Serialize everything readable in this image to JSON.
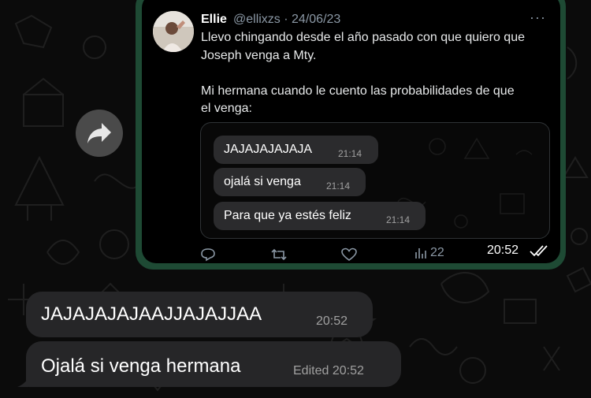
{
  "tweet": {
    "author_name": "Ellie",
    "handle": "@ellixzs",
    "date": "24/06/23",
    "more": "···",
    "text": "Llevo chingando desde el año pasado con que quiero que\nJoseph venga a Mty.\n\nMi hermana cuando le cuento las probabilidades de que\nel venga:",
    "embedded_messages": [
      {
        "text": "JAJAJAJAJAJA",
        "time": "21:14"
      },
      {
        "text": "ojalá si venga",
        "time": "21:14"
      },
      {
        "text": "Para que ya estés feliz",
        "time": "21:14"
      }
    ],
    "actions": {
      "views": "22"
    }
  },
  "outgoing": {
    "time": "20:52",
    "status": "read"
  },
  "incoming": [
    {
      "text": "JAJAJAJAJAAJJAJAJJAA",
      "time": "20:52"
    },
    {
      "text": "Ojalá si venga hermana",
      "edited": "Edited",
      "time": "20:52"
    }
  ],
  "icons": {
    "forward": "forward-arrow-icon",
    "reply": "reply-icon",
    "retweet": "retweet-icon",
    "like": "heart-icon",
    "views": "views-icon",
    "read": "double-check-icon"
  },
  "colors": {
    "background": "#0b0b0b",
    "outgoing_bubble": "#1e4a34",
    "incoming_bubble": "#262628",
    "tweet_card": "#000000",
    "muted_text": "#8b98a5"
  }
}
